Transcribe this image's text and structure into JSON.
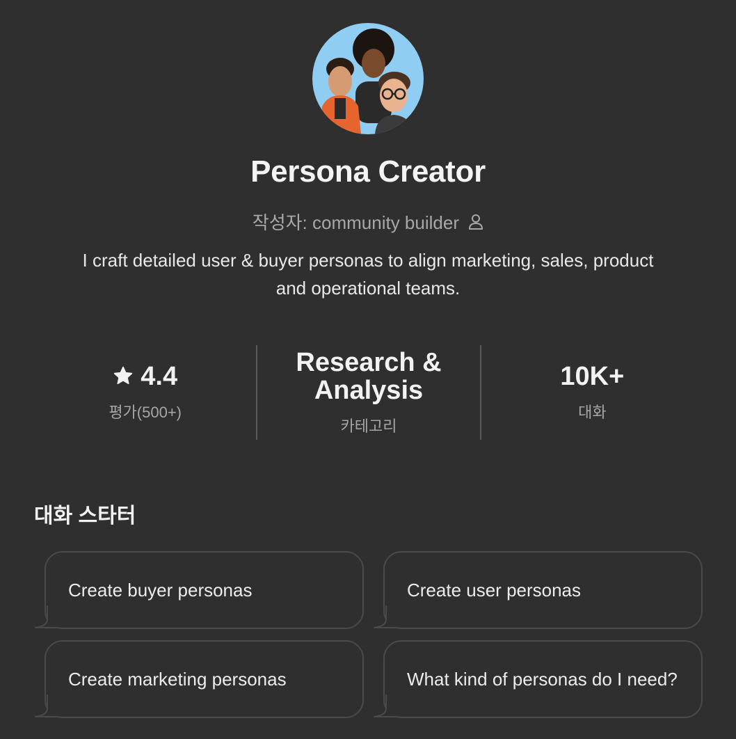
{
  "gpt": {
    "name": "Persona Creator",
    "author_prefix": "작성자:",
    "author_name": "community builder",
    "description": "I craft detailed user & buyer personas to align marketing, sales, product and operational teams."
  },
  "stats": {
    "rating": {
      "value": "4.4",
      "label": "평가(500+)",
      "icon": "star-icon"
    },
    "category": {
      "value": "Research & Analysis",
      "label": "카테고리"
    },
    "conversations": {
      "value": "10K+",
      "label": "대화"
    }
  },
  "starters": {
    "heading": "대화 스타터",
    "items": [
      {
        "label": "Create buyer personas"
      },
      {
        "label": "Create user personas"
      },
      {
        "label": "Create marketing personas"
      },
      {
        "label": "What kind of personas do I need?"
      }
    ]
  },
  "colors": {
    "background": "#2f2f2f",
    "card_border": "#4a4a4a",
    "muted_text": "#a8a8a8",
    "avatar_bg": "#8fcdf2"
  }
}
